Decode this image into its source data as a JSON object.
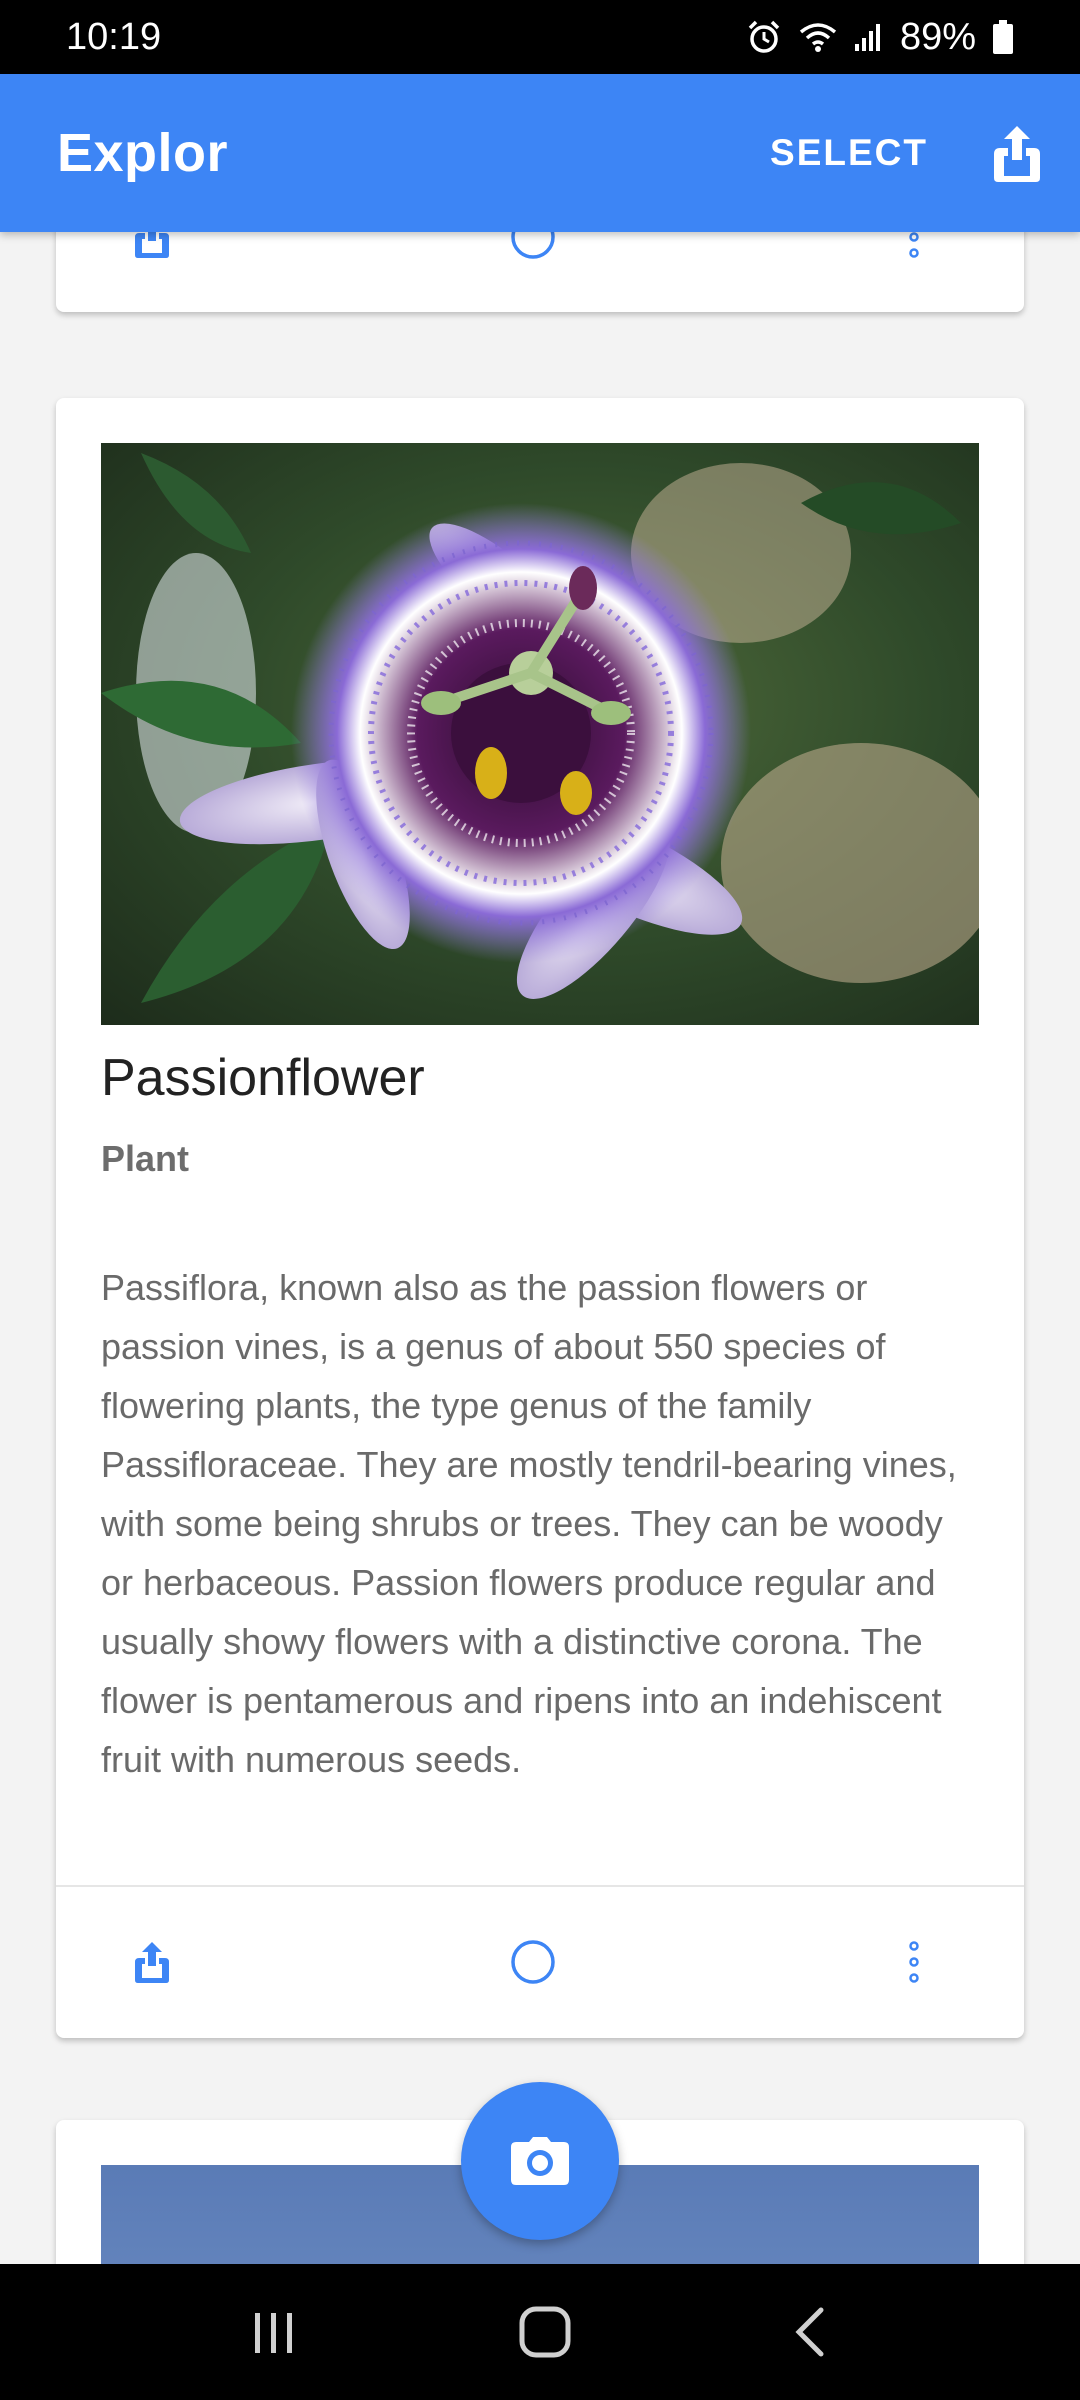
{
  "status_bar": {
    "time": "10:19",
    "battery": "89%",
    "icons": [
      "alarm-icon",
      "wifi-icon",
      "signal-icon",
      "battery-icon"
    ]
  },
  "app_bar": {
    "title": "Explor",
    "select_label": "SELECT",
    "share_icon": "share-icon",
    "color": "#3d85f5"
  },
  "cards": [
    {
      "actions": [
        "share-icon",
        "circle-icon",
        "more-vert-icon"
      ]
    },
    {
      "name": "Passionflower",
      "type": "Plant",
      "description": "Passiflora, known also as the passion flowers or passion vines, is a genus of about 550 species of flowering plants, the type genus of the family Passifloraceae. They are mostly tendril-bearing vines, with some being shrubs or trees. They can be woody or herbaceous. Passion flowers produce regular and usually showy flowers with a distinctive corona. The flower is pentamerous and ripens into an indehiscent fruit with numerous seeds.",
      "actions": [
        "share-icon",
        "circle-icon",
        "more-vert-icon"
      ]
    },
    {
      "image": "sky-photo"
    }
  ],
  "fab": {
    "icon": "camera-icon"
  },
  "nav_bar": {
    "icons": [
      "recents-icon",
      "home-icon",
      "back-icon"
    ]
  }
}
